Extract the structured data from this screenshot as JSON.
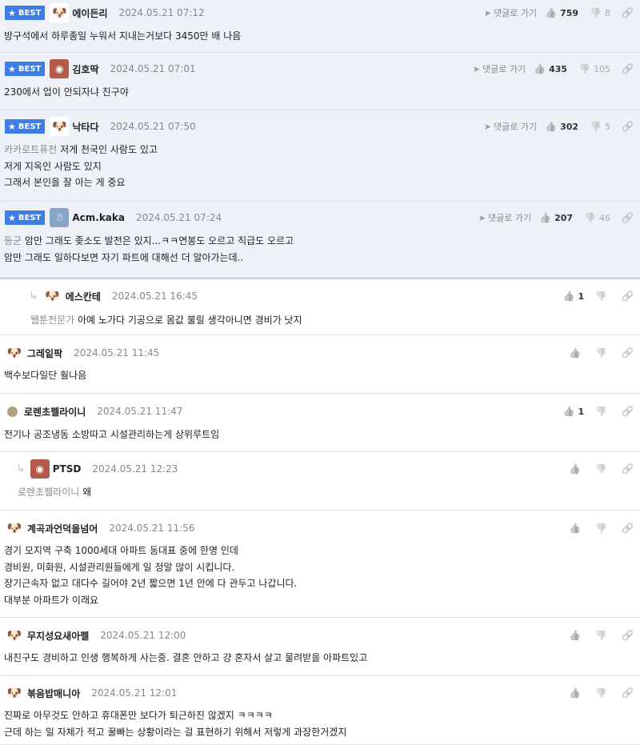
{
  "labels": {
    "best": "BEST",
    "goto_reply": "댓글로 가기"
  },
  "comments": [
    {
      "best": true,
      "nick": "에이든리",
      "date": "2024.05.21 07:12",
      "up": "759",
      "down": "8",
      "tag": "",
      "lines": [
        "방구석에서 하루종일 누워서 지내는거보다 3450만 배 나음"
      ],
      "avatar": "dog"
    },
    {
      "best": true,
      "nick": "김호딱",
      "date": "2024.05.21 07:01",
      "up": "435",
      "down": "105",
      "tag": "",
      "lines": [
        "230에서 업이 안되자냐 친구야"
      ],
      "avatar": "pic2"
    },
    {
      "best": true,
      "nick": "낙타다",
      "date": "2024.05.21 07:50",
      "up": "302",
      "down": "5",
      "tag": "카카로트퓨전",
      "lines": [
        " 저게 천국인 사람도 있고",
        "저게 지옥인 사람도 있지",
        "그래서 본인을 잘 아는 게 중요"
      ],
      "avatar": "dog"
    },
    {
      "best": true,
      "nick": "Acm.kaka",
      "date": "2024.05.21 07:24",
      "up": "207",
      "down": "46",
      "tag": "등군",
      "lines": [
        " 암만 그래도 좆소도 발전은 있지...ㅋㅋ연봉도 오르고 직급도 오르고",
        "암만 그래도 일하다보면 자기 파트에 대해선 더 알아가는데.."
      ],
      "avatar": "pic"
    },
    {
      "best": false,
      "reply": true,
      "nick": "에스칸테",
      "date": "2024.05.21 16:45",
      "up": "1",
      "tag": "웹툰전문가",
      "lines": [
        " 아예 노가다 기공으로 몸값 불릴 생각아니면 경비가 낫지"
      ],
      "avatar": "dog"
    },
    {
      "best": false,
      "nick": "그레잍팍",
      "date": "2024.05.21 11:45",
      "up": "",
      "tag": "",
      "lines": [
        "백수보다일단 훨나음"
      ],
      "avatar": "dog"
    },
    {
      "best": false,
      "nick": "로렌초펠라이니",
      "date": "2024.05.21 11:47",
      "up": "1",
      "tag": "",
      "lines": [
        "전기나 공조냉동 소방따고 시설관리하는게 상위루트임"
      ],
      "avatar": "ball"
    },
    {
      "best": false,
      "reply": true,
      "nick": "PTSD",
      "date": "2024.05.21 12:23",
      "up": "",
      "tag": "로렌초펠라이니",
      "lines": [
        " 왜"
      ],
      "avatar": "pic2"
    },
    {
      "best": false,
      "nick": "계곡과언덕을넘어",
      "date": "2024.05.21 11:56",
      "up": "",
      "tag": "",
      "lines": [
        "경기 모지역 구축 1000세대 아파트 동대표 중에 한명 인데",
        "경비원, 미화원, 시설관리원들에게 일 정말 많이 시킵니다.",
        "장기근속자 없고 대다수 길어야 2년 짧으면 1년 안에 다 관두고 나갑니다.",
        "대부분 아파트가 이래요"
      ],
      "avatar": "dog"
    },
    {
      "best": false,
      "nick": "무지성요새아펠",
      "date": "2024.05.21 12:00",
      "up": "",
      "tag": "",
      "lines": [
        "내친구도 경비하고 인생 행복하게 사는중. 결혼 안하고 걍 혼자서 살고 물려받을 아파트있고"
      ],
      "avatar": "dog"
    },
    {
      "best": false,
      "nick": "볶음밥매니아",
      "date": "2024.05.21 12:01",
      "up": "",
      "tag": "",
      "lines": [
        "진짜로 아무것도 안하고 휴대폰만 보다가 퇴근하진 않겠지 ㅋㅋㅋㅋ",
        "근데 하는 일 자체가 적고 꿀빠는 상황이라는 걸 표현하기 위해서 저렇게 과장한거겠지"
      ],
      "avatar": "dog"
    }
  ]
}
